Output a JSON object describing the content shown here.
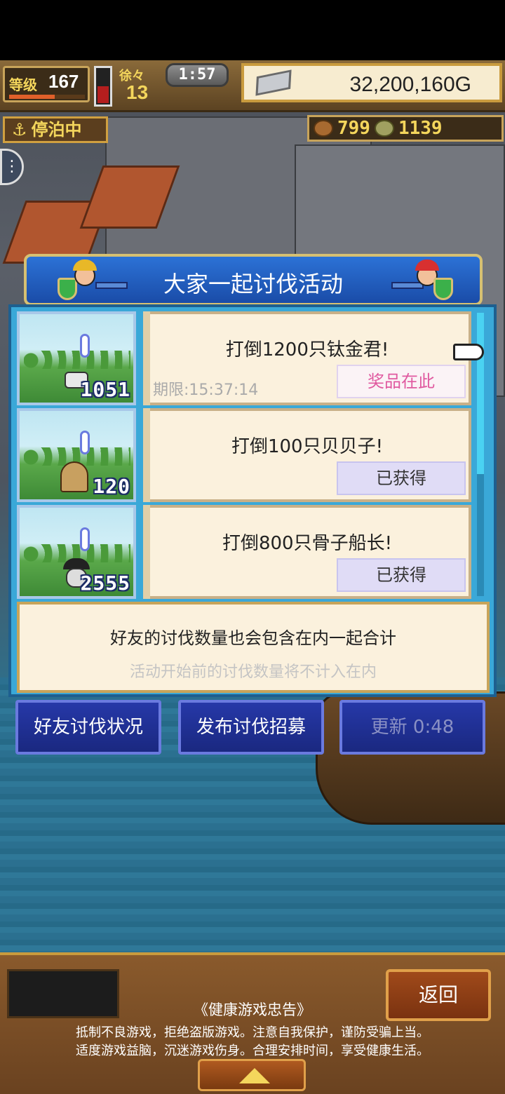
{
  "hud": {
    "level_label": "等级",
    "level_value": "167",
    "level_progress": 0.6,
    "energy_level": 0.5,
    "gem_label": "徐々",
    "gem_value": "13",
    "timer": "1:57",
    "gold": "32,200,160G",
    "dock_status": "停泊中",
    "resource_1": "799",
    "resource_2": "1139"
  },
  "event": {
    "title": "大家一起讨伐活动",
    "quests": [
      {
        "target": "打倒1200只钛金君!",
        "count": "1051",
        "deadline": "期限:15:37:14",
        "status": "奖品在此"
      },
      {
        "target": "打倒100只贝贝子!",
        "count": "120",
        "status": "已获得"
      },
      {
        "target": "打倒800只骨子船长!",
        "count": "2555",
        "status": "已获得"
      }
    ],
    "info_main": "好友的讨伐数量也会包含在内一起合计",
    "info_sub": "活动开始前的讨伐数量将不计入在内",
    "buttons": {
      "friends": "好友讨伐状况",
      "recruit": "发布讨伐招募",
      "refresh": "更新 0:48"
    }
  },
  "footer": {
    "back": "返回",
    "notice_title": "《健康游戏忠告》",
    "notice_line1": "抵制不良游戏，拒绝盗版游戏。注意自我保护，谨防受骗上当。",
    "notice_line2": "适度游戏益脑，沉迷游戏伤身。合理安排时间，享受健康生活。"
  },
  "colors": {
    "modal_blue": "#3aa8d8",
    "button_blue": "#2638a8",
    "gold_text": "#f4d65c",
    "prize_pink": "#e05aa0"
  },
  "icons": {
    "gold": "silver-bar-icon",
    "dock": "anchor-icon",
    "resource_1": "wood-log-icon",
    "resource_2": "coin-icon",
    "pointer": "hand-pointer-icon",
    "up": "up-arrow-icon"
  }
}
